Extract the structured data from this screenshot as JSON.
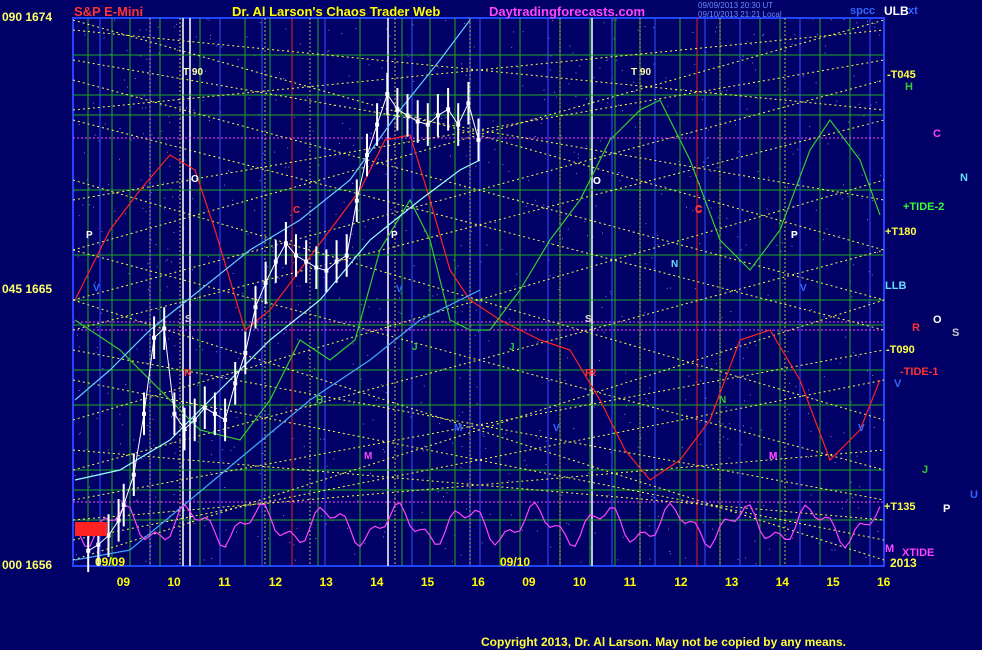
{
  "header": {
    "symbol": "S&P E-Mini",
    "title": "Dr. Al Larson's Chaos Trader Web",
    "site": "Daytradingforecasts.com",
    "timestamp_1": "09/09/2013 20:30 UT",
    "timestamp_2": "09/10/2013 21:21 Local",
    "top_right_label": "spcc",
    "top_right_suffix": "xt",
    "ulb_label": "ULB"
  },
  "footer": {
    "copyright": "Copyright 2013, Dr. Al Larson. May not be copied by any means."
  },
  "y_axis_labels": [
    {
      "text": "090 1674",
      "price": 1674
    },
    {
      "text": "045 1665",
      "price": 1665
    },
    {
      "text": "000 1656",
      "price": 1656
    }
  ],
  "right_labels": {
    "t045": "-T045",
    "h": "H",
    "c": "C",
    "n": "N",
    "tide2": "+TIDE-2",
    "t180": "+T180",
    "llb": "LLB",
    "r": "R",
    "o": "O",
    "s": "S",
    "t090": "-T090",
    "tide1": "-TIDE-1",
    "v": "V",
    "j": "J",
    "u": "U",
    "t135": "+T135",
    "p": "P",
    "m": "M",
    "xtide": "XTIDE",
    "year": "2013"
  },
  "colors": {
    "background": "#000066",
    "price_bars": "#ffffff",
    "red_line": "#ff2222",
    "green_line": "#33cc33",
    "cyan_line": "#66ccff",
    "light_cyan": "#99ffff",
    "magenta_tide": "#ff44ff",
    "yellow_grid": "#ffff44",
    "green_grid": "#22aa22",
    "title_color": "#ffff00",
    "symbol_color": "#ff3333",
    "site_color": "#ff44ff"
  },
  "chart_data": {
    "type": "line",
    "title": "S&P E-Mini",
    "ylim": [
      1656,
      1674
    ],
    "y_ticks": [
      1656,
      1665,
      1674
    ],
    "x_day_labels": [
      "09/09",
      "09/10"
    ],
    "x_hour_ticks_day1": [
      "09",
      "10",
      "11",
      "12",
      "13",
      "14",
      "15",
      "16"
    ],
    "x_hour_ticks_day2": [
      "09",
      "10",
      "11",
      "12",
      "13",
      "14",
      "15",
      "16"
    ],
    "price_series": {
      "name": "S&P E-Mini price",
      "x_hours": [
        8.3,
        8.5,
        8.7,
        8.9,
        9.0,
        9.2,
        9.4,
        9.6,
        9.8,
        10.0,
        10.2,
        10.4,
        10.6,
        10.8,
        11.0,
        11.2,
        11.4,
        11.6,
        11.8,
        12.0,
        12.2,
        12.4,
        12.6,
        12.8,
        13.0,
        13.2,
        13.4,
        13.6,
        13.8,
        14.0,
        14.2,
        14.4,
        14.6,
        14.8,
        15.0,
        15.2,
        15.4,
        15.6,
        15.8,
        16.0
      ],
      "values": [
        1656.5,
        1656.7,
        1657.0,
        1657.5,
        1658.0,
        1659.0,
        1661.0,
        1663.5,
        1663.8,
        1661.0,
        1660.5,
        1660.8,
        1661.2,
        1661.0,
        1660.8,
        1662.0,
        1663.0,
        1664.5,
        1665.3,
        1666.0,
        1666.6,
        1666.2,
        1666.0,
        1665.8,
        1665.7,
        1666.0,
        1666.2,
        1668.0,
        1669.5,
        1670.5,
        1671.5,
        1671.0,
        1670.8,
        1670.6,
        1670.5,
        1670.8,
        1671.0,
        1670.5,
        1671.2,
        1670.0
      ]
    },
    "markers": {
      "t90": "T 90",
      "day1_letters": [
        "P",
        "V",
        "O",
        "C",
        "S",
        "R",
        "H",
        "M",
        "P",
        "V",
        "J",
        "M",
        "S",
        "C",
        "R",
        "V"
      ],
      "day2_letters": [
        "O",
        "P",
        "C",
        "N",
        "S",
        "R",
        "J",
        "N",
        "M",
        "V",
        "P",
        "V",
        "M",
        "O"
      ]
    }
  }
}
